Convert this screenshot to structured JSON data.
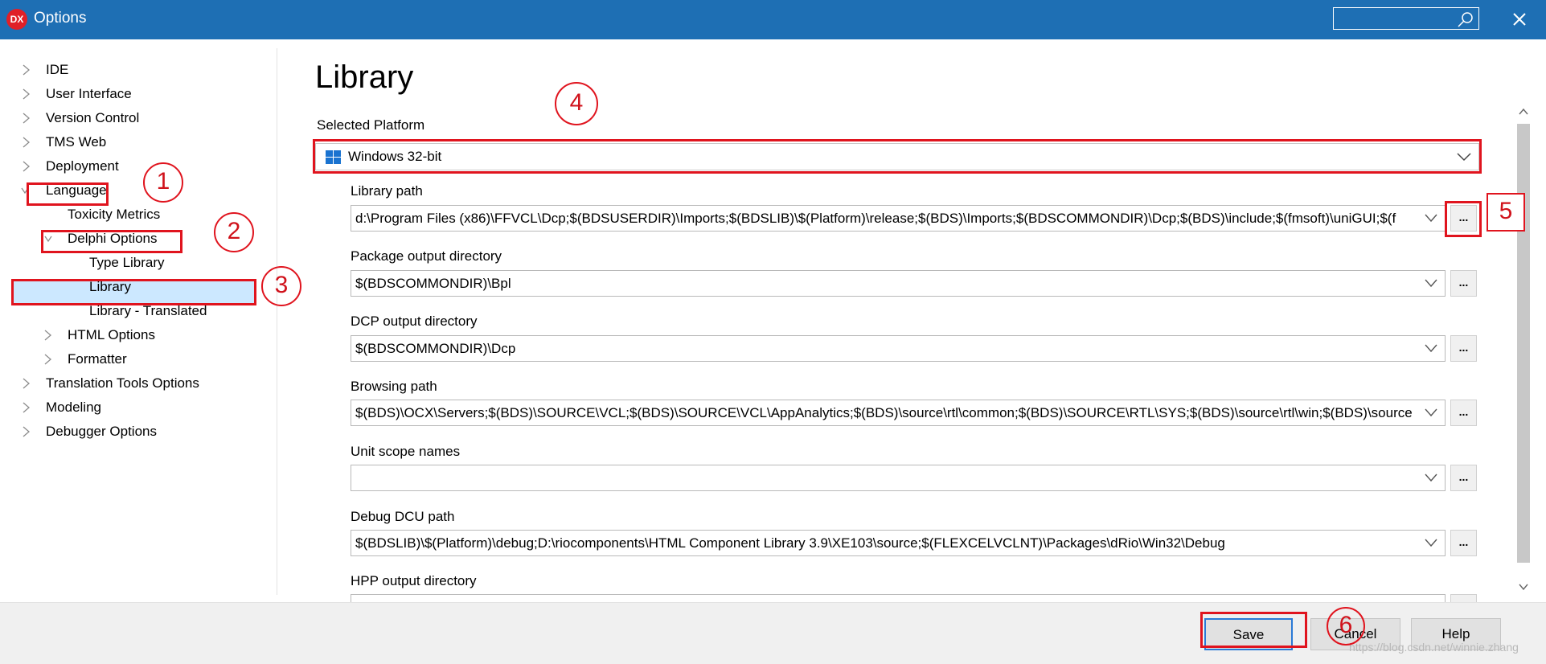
{
  "window": {
    "title": "Options",
    "logo_text": "DX",
    "search_placeholder": ""
  },
  "tree": {
    "items": [
      {
        "label": "IDE"
      },
      {
        "label": "User Interface"
      },
      {
        "label": "Version Control"
      },
      {
        "label": "TMS Web"
      },
      {
        "label": "Deployment"
      },
      {
        "label": "Language"
      },
      {
        "label": "Toxicity Metrics"
      },
      {
        "label": "Delphi Options"
      },
      {
        "label": "Type Library"
      },
      {
        "label": "Library"
      },
      {
        "label": "Library - Translated"
      },
      {
        "label": "HTML Options"
      },
      {
        "label": "Formatter"
      },
      {
        "label": "Translation Tools Options"
      },
      {
        "label": "Modeling"
      },
      {
        "label": "Debugger Options"
      }
    ],
    "selected": "Library"
  },
  "main": {
    "title": "Library",
    "platform_label": "Selected Platform",
    "platform_value": "Windows 32-bit",
    "fields": [
      {
        "label": "Library path",
        "value": "d:\\Program Files (x86)\\FFVCL\\Dcp;$(BDSUSERDIR)\\Imports;$(BDSLIB)\\$(Platform)\\release;$(BDS)\\Imports;$(BDSCOMMONDIR)\\Dcp;$(BDS)\\include;$(fmsoft)\\uniGUI;$(f"
      },
      {
        "label": "Package output directory",
        "value": "$(BDSCOMMONDIR)\\Bpl"
      },
      {
        "label": "DCP output directory",
        "value": "$(BDSCOMMONDIR)\\Dcp"
      },
      {
        "label": "Browsing path",
        "value": "$(BDS)\\OCX\\Servers;$(BDS)\\SOURCE\\VCL;$(BDS)\\SOURCE\\VCL\\AppAnalytics;$(BDS)\\source\\rtl\\common;$(BDS)\\SOURCE\\RTL\\SYS;$(BDS)\\source\\rtl\\win;$(BDS)\\source"
      },
      {
        "label": "Unit scope names",
        "value": ""
      },
      {
        "label": "Debug DCU path",
        "value": "$(BDSLIB)\\$(Platform)\\debug;D:\\riocomponents\\HTML Component Library 3.9\\XE103\\source;$(FLEXCELVCLNT)\\Packages\\dRio\\Win32\\Debug"
      },
      {
        "label": "HPP output directory",
        "value": ""
      }
    ],
    "browse_label": "..."
  },
  "buttons": {
    "save": "Save",
    "cancel": "Cancel",
    "help": "Help"
  },
  "annotations": [
    "1",
    "2",
    "3",
    "4",
    "5",
    "6"
  ],
  "watermark": "https://blog.csdn.net/winnie.zhang",
  "colors": {
    "titlebar": "#1e6fb4",
    "annotation_red": "#e0141e",
    "selection": "#cce8ff"
  }
}
